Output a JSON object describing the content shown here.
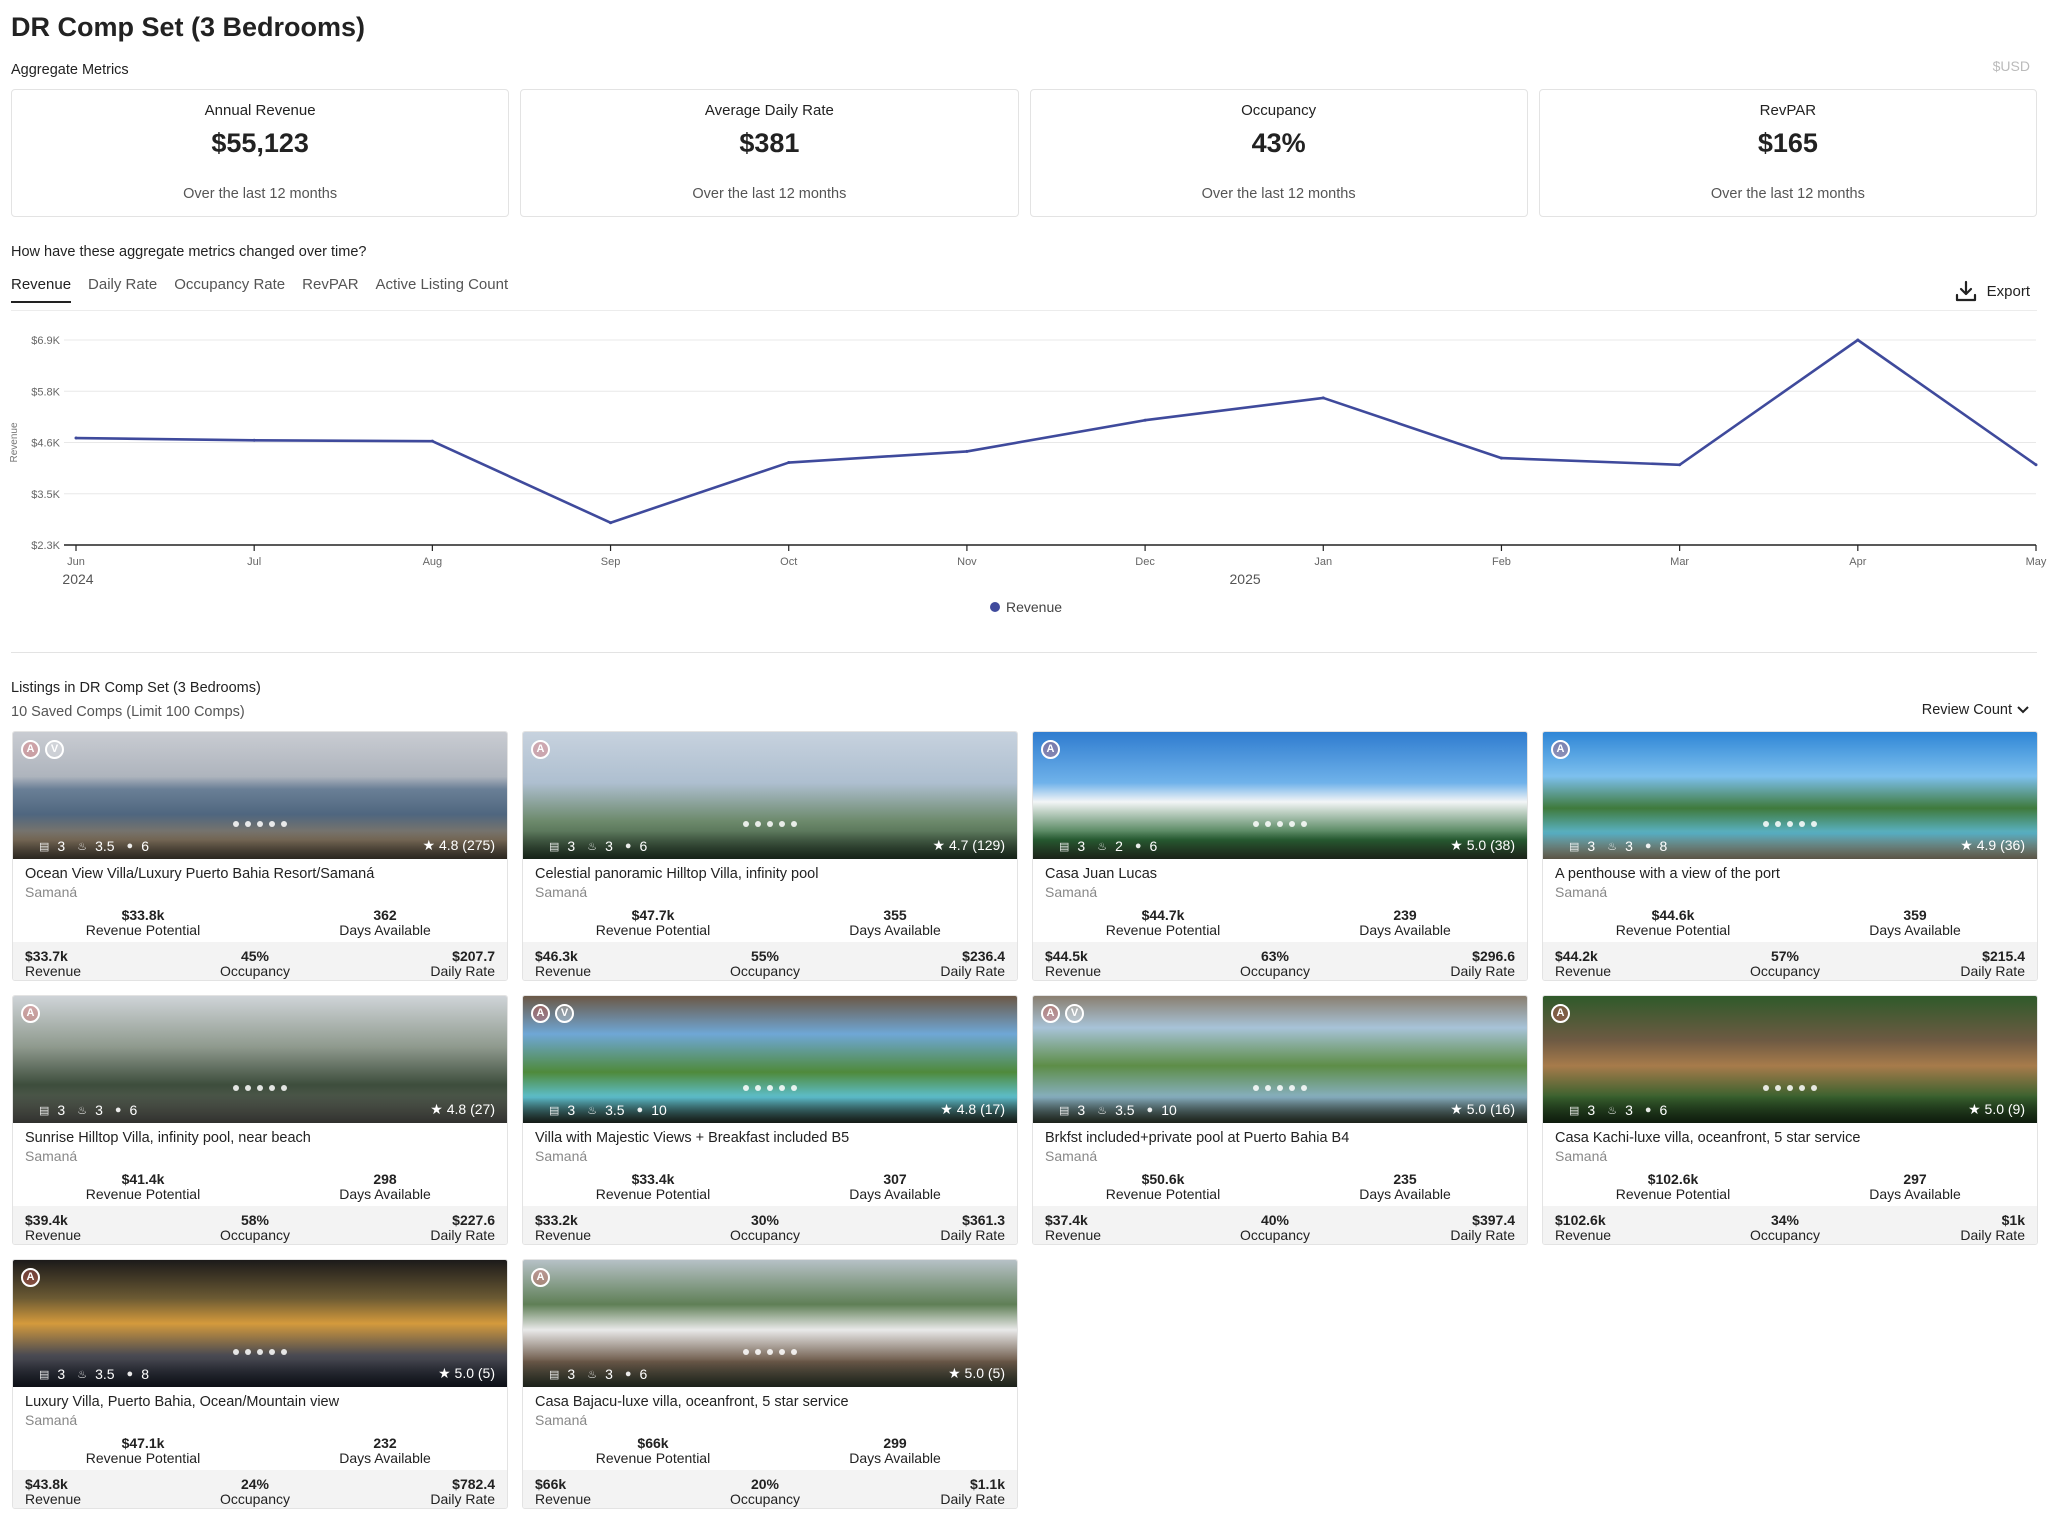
{
  "page": {
    "title": "DR Comp Set (3 Bedrooms)",
    "aggregate_label": "Aggregate Metrics",
    "currency": "$USD"
  },
  "metrics": [
    {
      "label": "Annual Revenue",
      "value": "$55,123",
      "sub": "Over the last 12 months"
    },
    {
      "label": "Average Daily Rate",
      "value": "$381",
      "sub": "Over the last 12 months"
    },
    {
      "label": "Occupancy",
      "value": "43%",
      "sub": "Over the last 12 months"
    },
    {
      "label": "RevPAR",
      "value": "$165",
      "sub": "Over the last 12 months"
    }
  ],
  "trend": {
    "question": "How have these aggregate metrics changed over time?",
    "tabs": [
      "Revenue",
      "Daily Rate",
      "Occupancy Rate",
      "RevPAR",
      "Active Listing Count"
    ],
    "active_tab": "Revenue",
    "export_label": "Export"
  },
  "chart_data": {
    "type": "line",
    "x": [
      "Jun",
      "Jul",
      "Aug",
      "Sep",
      "Oct",
      "Nov",
      "Dec",
      "Jan",
      "Feb",
      "Mar",
      "Apr",
      "May"
    ],
    "year_labels": [
      {
        "label": "2024",
        "at": "Jun"
      },
      {
        "label": "2025",
        "at": "Dec"
      }
    ],
    "series": [
      {
        "name": "Revenue",
        "color": "#3f4a9c",
        "values": [
          4.7,
          4.65,
          4.63,
          2.8,
          4.15,
          4.4,
          5.1,
          5.6,
          4.25,
          4.1,
          6.9,
          4.1
        ]
      }
    ],
    "y_ticks": [
      "$2.3K",
      "$3.5K",
      "$4.6K",
      "$5.8K",
      "$6.9K"
    ],
    "ylim": [
      2.3,
      6.9
    ],
    "ylabel": "Revenue",
    "legend": "bottom-center",
    "grid": true
  },
  "listings_section": {
    "title": "Listings in DR Comp Set (3 Bedrooms)",
    "count_text": "10 Saved Comps (Limit 100 Comps)",
    "sort_label": "Review Count"
  },
  "labels": {
    "revenue_potential": "Revenue Potential",
    "days_available": "Days Available",
    "revenue": "Revenue",
    "occupancy": "Occupancy",
    "daily_rate": "Daily Rate"
  },
  "listings": [
    {
      "title": "Ocean View Villa/Luxury Puerto Bahia Resort/Samaná",
      "location": "Samaná",
      "bedrooms": "3",
      "baths": "3.5",
      "guests": "6",
      "rating": "4.8 (275)",
      "revenue_potential": "$33.8k",
      "days_available": "362",
      "revenue": "$33.7k",
      "occupancy": "45%",
      "daily_rate": "$207.7",
      "logos": 2
    },
    {
      "title": "Celestial panoramic Hilltop Villa, infinity pool",
      "location": "Samaná",
      "bedrooms": "3",
      "baths": "3",
      "guests": "6",
      "rating": "4.7 (129)",
      "revenue_potential": "$47.7k",
      "days_available": "355",
      "revenue": "$46.3k",
      "occupancy": "55%",
      "daily_rate": "$236.4",
      "logos": 1
    },
    {
      "title": "Casa Juan Lucas",
      "location": "Samaná",
      "bedrooms": "3",
      "baths": "2",
      "guests": "6",
      "rating": "5.0 (38)",
      "revenue_potential": "$44.7k",
      "days_available": "239",
      "revenue": "$44.5k",
      "occupancy": "63%",
      "daily_rate": "$296.6",
      "logos": 1
    },
    {
      "title": "A penthouse with a view of the port",
      "location": "Samaná",
      "bedrooms": "3",
      "baths": "3",
      "guests": "8",
      "rating": "4.9 (36)",
      "revenue_potential": "$44.6k",
      "days_available": "359",
      "revenue": "$44.2k",
      "occupancy": "57%",
      "daily_rate": "$215.4",
      "logos": 1
    },
    {
      "title": "Sunrise Hilltop Villa, infinity pool, near beach",
      "location": "Samaná",
      "bedrooms": "3",
      "baths": "3",
      "guests": "6",
      "rating": "4.8 (27)",
      "revenue_potential": "$41.4k",
      "days_available": "298",
      "revenue": "$39.4k",
      "occupancy": "58%",
      "daily_rate": "$227.6",
      "logos": 1
    },
    {
      "title": "Villa with Majestic Views + Breakfast included B5",
      "location": "Samaná",
      "bedrooms": "3",
      "baths": "3.5",
      "guests": "10",
      "rating": "4.8 (17)",
      "revenue_potential": "$33.4k",
      "days_available": "307",
      "revenue": "$33.2k",
      "occupancy": "30%",
      "daily_rate": "$361.3",
      "logos": 2
    },
    {
      "title": "Brkfst included+private pool at Puerto Bahia B4",
      "location": "Samaná",
      "bedrooms": "3",
      "baths": "3.5",
      "guests": "10",
      "rating": "5.0 (16)",
      "revenue_potential": "$50.6k",
      "days_available": "235",
      "revenue": "$37.4k",
      "occupancy": "40%",
      "daily_rate": "$397.4",
      "logos": 2
    },
    {
      "title": "Casa Kachi-luxe villa, oceanfront, 5 star service",
      "location": "Samaná",
      "bedrooms": "3",
      "baths": "3",
      "guests": "6",
      "rating": "5.0 (9)",
      "revenue_potential": "$102.6k",
      "days_available": "297",
      "revenue": "$102.6k",
      "occupancy": "34%",
      "daily_rate": "$1k",
      "logos": 1
    },
    {
      "title": "Luxury Villa, Puerto Bahia, Ocean/Mountain view",
      "location": "Samaná",
      "bedrooms": "3",
      "baths": "3.5",
      "guests": "8",
      "rating": "5.0 (5)",
      "revenue_potential": "$47.1k",
      "days_available": "232",
      "revenue": "$43.8k",
      "occupancy": "24%",
      "daily_rate": "$782.4",
      "logos": 1
    },
    {
      "title": "Casa Bajacu-luxe villa, oceanfront, 5 star service",
      "location": "Samaná",
      "bedrooms": "3",
      "baths": "3",
      "guests": "6",
      "rating": "5.0 (5)",
      "revenue_potential": "$66k",
      "days_available": "299",
      "revenue": "$66k",
      "occupancy": "20%",
      "daily_rate": "$1.1k",
      "logos": 1
    }
  ]
}
